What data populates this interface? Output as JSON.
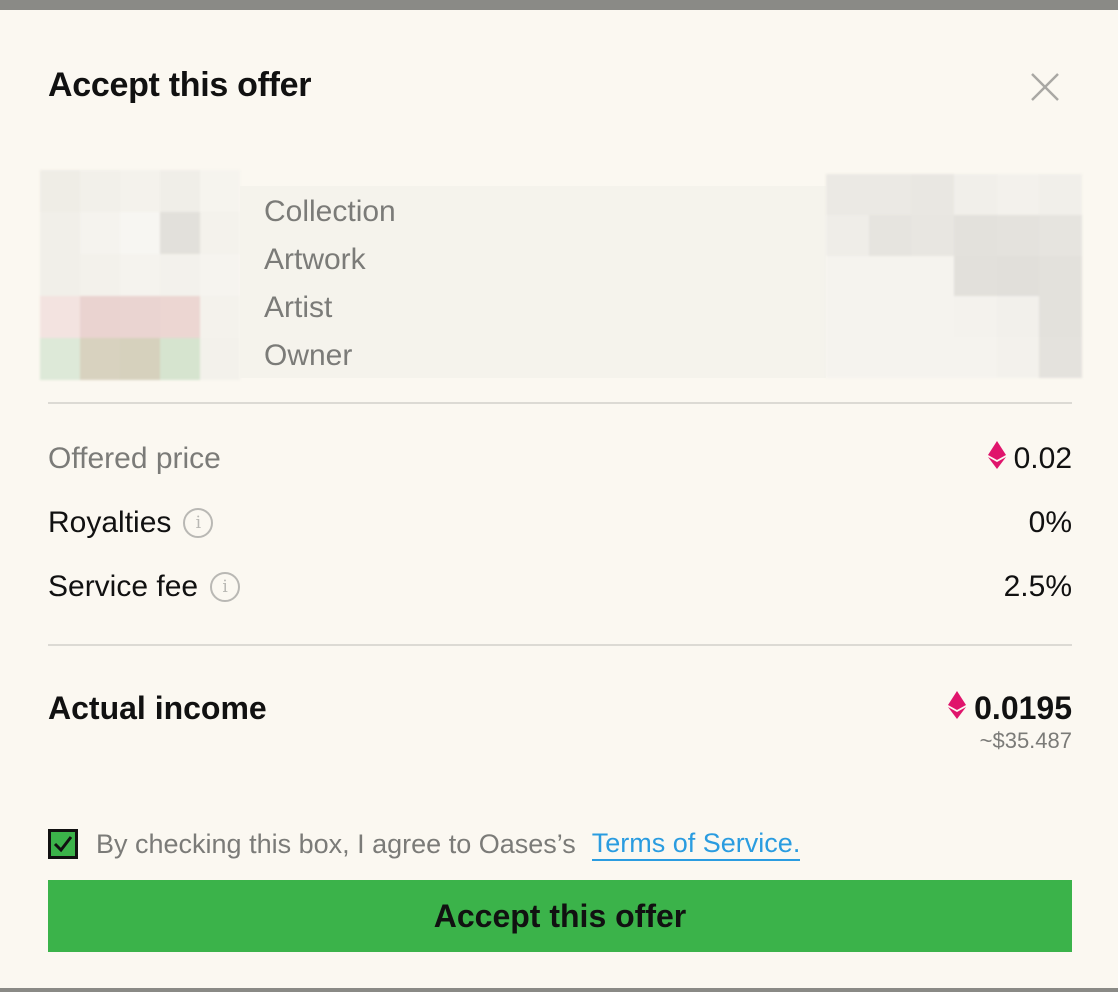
{
  "dialog": {
    "title": "Accept this offer",
    "close_icon": "close-icon"
  },
  "artwork": {
    "labels": [
      "Collection",
      "Artwork",
      "Artist",
      "Owner"
    ]
  },
  "pricing": {
    "offered_price_label": "Offered price",
    "offered_price_value": "0.02",
    "royalties_label": "Royalties",
    "royalties_value": "0%",
    "service_fee_label": "Service fee",
    "service_fee_value": "2.5%",
    "info_icon": "info-icon",
    "currency_icon": "ethereum-icon",
    "currency_color": "#e0156c"
  },
  "income": {
    "label": "Actual income",
    "value": "0.0195",
    "usd": "~$35.487"
  },
  "agreement": {
    "checked": true,
    "text": "By checking this box, I agree to Oases’s",
    "link_text": "Terms of Service."
  },
  "actions": {
    "accept_label": "Accept this offer",
    "accent_color": "#3bb34a"
  }
}
